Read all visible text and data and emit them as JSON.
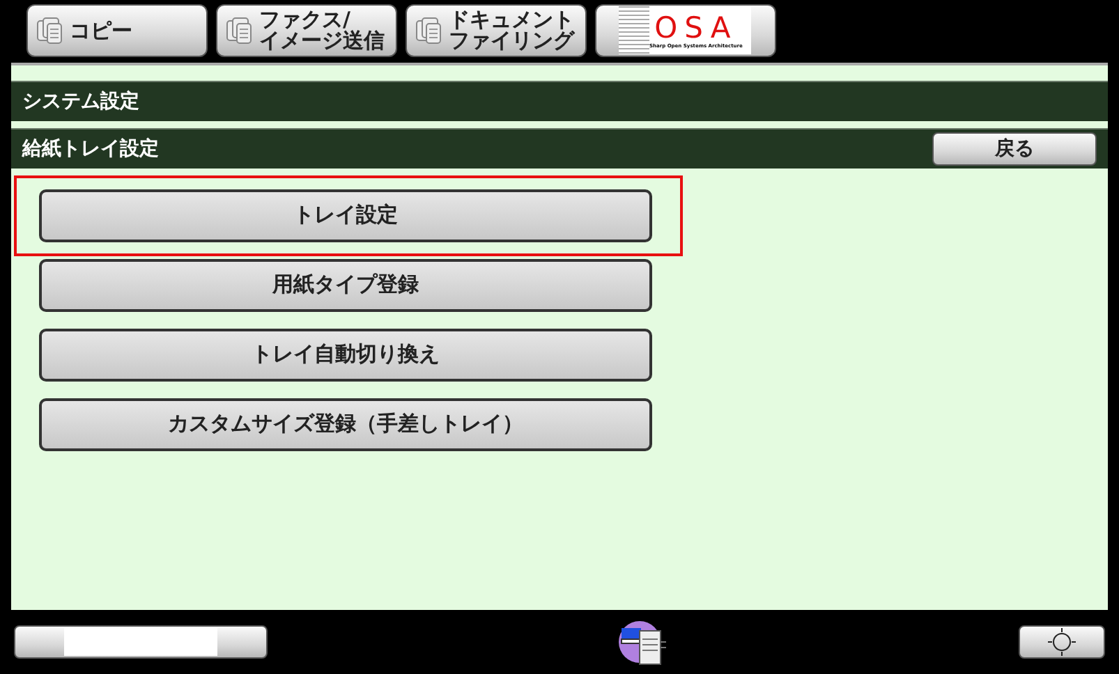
{
  "mode_tabs": [
    {
      "kind": "icon",
      "lines": [
        "コピー"
      ]
    },
    {
      "kind": "icon",
      "lines": [
        "ファクス/",
        "イメージ送信"
      ]
    },
    {
      "kind": "icon",
      "lines": [
        "ドキュメント",
        "ファイリング"
      ]
    },
    {
      "kind": "logo",
      "label": "OSA",
      "subtitle": "Sharp Open Systems Architecture"
    }
  ],
  "title_bar": "システム設定",
  "sub_bar": {
    "title": "給紙トレイ設定",
    "back_button": "戻る"
  },
  "menu": [
    {
      "label": "トレイ設定",
      "highlighted": true
    },
    {
      "label": "用紙タイプ登録",
      "highlighted": false
    },
    {
      "label": "トレイ自動切り換え",
      "highlighted": false
    },
    {
      "label": "カスタムサイズ登録（手差しトレイ）",
      "highlighted": false
    }
  ]
}
